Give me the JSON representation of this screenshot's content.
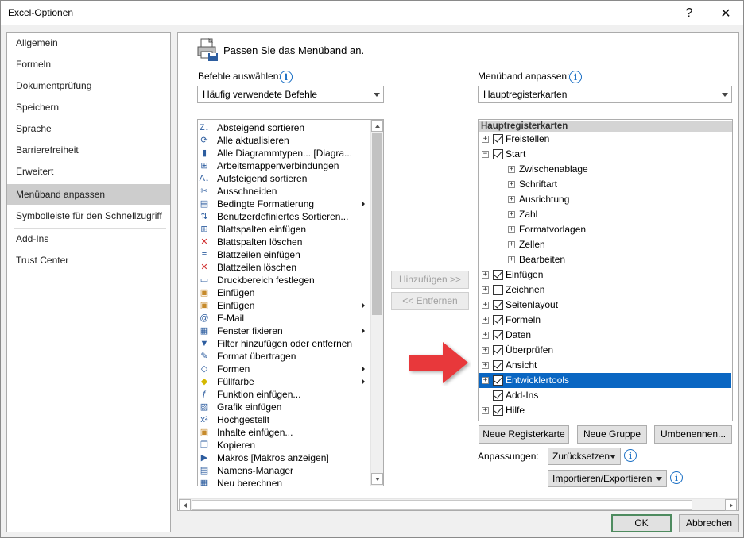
{
  "window": {
    "title": "Excel-Optionen",
    "help_label": "?",
    "close_label": "✕"
  },
  "nav": {
    "items": [
      {
        "label": "Allgemein"
      },
      {
        "label": "Formeln"
      },
      {
        "label": "Dokumentprüfung"
      },
      {
        "label": "Speichern"
      },
      {
        "label": "Sprache"
      },
      {
        "label": "Barrierefreiheit"
      },
      {
        "label": "Erweitert"
      },
      {
        "label": "Menüband anpassen",
        "selected": true
      },
      {
        "label": "Symbolleiste für den Schnellzugriff"
      },
      {
        "label": "Add-Ins"
      },
      {
        "label": "Trust Center"
      }
    ]
  },
  "main": {
    "title": "Passen Sie das Menüband an.",
    "choose_commands": {
      "label": "Befehle auswählen:",
      "value": "Häufig verwendete Befehle"
    },
    "customize_ribbon": {
      "label": "Menüband anpassen:",
      "value": "Hauptregisterkarten"
    },
    "commands": [
      {
        "label": "Absteigend sortieren",
        "icon": "sort-desc-icon"
      },
      {
        "label": "Alle aktualisieren",
        "icon": "refresh-icon"
      },
      {
        "label": "Alle Diagrammtypen... [Diagra...",
        "icon": "chart-icon"
      },
      {
        "label": "Arbeitsmappenverbindungen",
        "icon": "connections-icon"
      },
      {
        "label": "Aufsteigend sortieren",
        "icon": "sort-asc-icon"
      },
      {
        "label": "Ausschneiden",
        "icon": "scissors-icon"
      },
      {
        "label": "Bedingte Formatierung",
        "icon": "conditional-format-icon",
        "submenu": true
      },
      {
        "label": "Benutzerdefiniertes Sortieren...",
        "icon": "custom-sort-icon"
      },
      {
        "label": "Blattspalten einfügen",
        "icon": "insert-columns-icon"
      },
      {
        "label": "Blattspalten löschen",
        "icon": "delete-columns-icon"
      },
      {
        "label": "Blattzeilen einfügen",
        "icon": "insert-rows-icon"
      },
      {
        "label": "Blattzeilen löschen",
        "icon": "delete-rows-icon"
      },
      {
        "label": "Druckbereich festlegen",
        "icon": "print-area-icon"
      },
      {
        "label": "Einfügen",
        "icon": "paste-icon"
      },
      {
        "label": "Einfügen",
        "icon": "paste-icon",
        "split": true
      },
      {
        "label": "E-Mail",
        "icon": "email-icon"
      },
      {
        "label": "Fenster fixieren",
        "icon": "freeze-panes-icon",
        "submenu": true
      },
      {
        "label": "Filter hinzufügen oder entfernen",
        "icon": "filter-icon"
      },
      {
        "label": "Format übertragen",
        "icon": "format-painter-icon"
      },
      {
        "label": "Formen",
        "icon": "shapes-icon",
        "submenu": true
      },
      {
        "label": "Füllfarbe",
        "icon": "fill-color-icon",
        "split": true
      },
      {
        "label": "Funktion einfügen...",
        "icon": "function-icon"
      },
      {
        "label": "Grafik einfügen",
        "icon": "picture-icon"
      },
      {
        "label": "Hochgestellt",
        "icon": "superscript-icon"
      },
      {
        "label": "Inhalte einfügen...",
        "icon": "paste-special-icon"
      },
      {
        "label": "Kopieren",
        "icon": "copy-icon"
      },
      {
        "label": "Makros [Makros anzeigen]",
        "icon": "macros-icon"
      },
      {
        "label": "Namens-Manager",
        "icon": "name-manager-icon"
      },
      {
        "label": "Neu berechnen",
        "icon": "calculate-icon"
      }
    ],
    "add_button": "Hinzufügen >>",
    "remove_button": "<< Entfernen",
    "tree": {
      "header": "Hauptregisterkarten",
      "items": [
        {
          "label": "Freistellen",
          "level": 0,
          "expander": "+",
          "checked": true
        },
        {
          "label": "Start",
          "level": 0,
          "expander": "−",
          "checked": true
        },
        {
          "label": "Zwischenablage",
          "level": 1,
          "expander": "+"
        },
        {
          "label": "Schriftart",
          "level": 1,
          "expander": "+"
        },
        {
          "label": "Ausrichtung",
          "level": 1,
          "expander": "+"
        },
        {
          "label": "Zahl",
          "level": 1,
          "expander": "+"
        },
        {
          "label": "Formatvorlagen",
          "level": 1,
          "expander": "+"
        },
        {
          "label": "Zellen",
          "level": 1,
          "expander": "+"
        },
        {
          "label": "Bearbeiten",
          "level": 1,
          "expander": "+"
        },
        {
          "label": "Einfügen",
          "level": 0,
          "expander": "+",
          "checked": true
        },
        {
          "label": "Zeichnen",
          "level": 0,
          "expander": "+",
          "checked": false
        },
        {
          "label": "Seitenlayout",
          "level": 0,
          "expander": "+",
          "checked": true
        },
        {
          "label": "Formeln",
          "level": 0,
          "expander": "+",
          "checked": true
        },
        {
          "label": "Daten",
          "level": 0,
          "expander": "+",
          "checked": true
        },
        {
          "label": "Überprüfen",
          "level": 0,
          "expander": "+",
          "checked": true
        },
        {
          "label": "Ansicht",
          "level": 0,
          "expander": "+",
          "checked": true
        },
        {
          "label": "Entwicklertools",
          "level": 0,
          "expander": "+",
          "checked": true,
          "selected": true
        },
        {
          "label": "Add-Ins",
          "level": 0,
          "expander": "",
          "checked": true
        },
        {
          "label": "Hilfe",
          "level": 0,
          "expander": "+",
          "checked": true
        }
      ]
    },
    "new_tab_button": "Neue Registerkarte",
    "new_group_button": "Neue Gruppe",
    "rename_button": "Umbenennen...",
    "customizations_label": "Anpassungen:",
    "reset_button": "Zurücksetzen",
    "import_export_button": "Importieren/Exportieren"
  },
  "footer": {
    "ok_button": "OK",
    "cancel_button": "Abbrechen"
  },
  "colors": {
    "selection": "#0a66c2",
    "arrow": "#e8373a",
    "info": "#1a6fc4"
  }
}
